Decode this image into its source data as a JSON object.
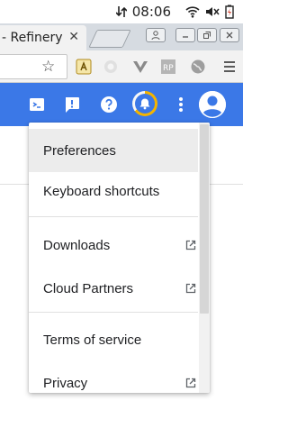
{
  "status_bar": {
    "time": "08:06",
    "icons": [
      "data-transfer-icon",
      "wifi-icon",
      "volume-muted-icon",
      "battery-charging-icon"
    ]
  },
  "browser": {
    "tab_title": "- Refinery",
    "tab_close": "✕",
    "window_buttons": [
      "user-icon",
      "minimize-icon",
      "restore-icon",
      "close-icon"
    ],
    "toolbar_icons": [
      "bookmark-star-icon",
      "extension-icon",
      "extension-icon",
      "extension-icon",
      "extension-icon",
      "globe-icon",
      "chrome-menu-icon"
    ]
  },
  "app_bar": {
    "icons": [
      "cloud-shell-icon",
      "alert-icon",
      "help-icon",
      "notifications-icon",
      "more-vert-icon",
      "account-avatar-icon"
    ],
    "accent_color": "#3b78e7",
    "progress_color": "#f4b400"
  },
  "menu": {
    "items": [
      {
        "label": "Preferences",
        "external": false,
        "selected": true
      },
      {
        "label": "Keyboard shortcuts",
        "external": false
      },
      {
        "label": "Downloads",
        "external": true
      },
      {
        "label": "Cloud Partners",
        "external": true
      },
      {
        "label": "Terms of service",
        "external": false
      },
      {
        "label": "Privacy",
        "external": true
      }
    ]
  }
}
